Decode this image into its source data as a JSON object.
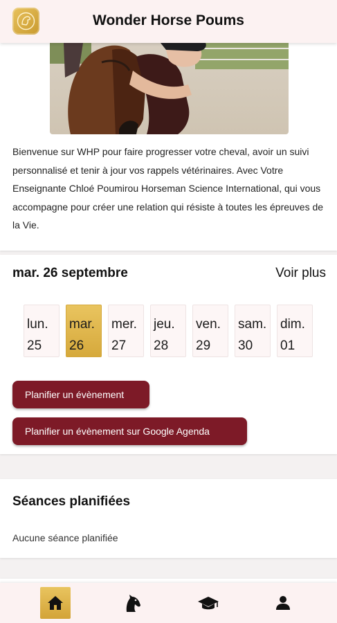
{
  "app": {
    "title": "Wonder Horse Poums"
  },
  "intro": {
    "text": "Bienvenue sur WHP pour faire progresser votre cheval, avoir un suivi personnalisé et tenir à jour vos rappels vétérinaires. Avec Votre Enseignante Chloé Poumirou Horseman Science International, qui vous accompagne pour créer une relation qui résiste à toutes les épreuves de la Vie."
  },
  "calendar": {
    "current_date": "mar. 26 septembre",
    "see_more": "Voir plus",
    "days": [
      {
        "name": "lun.",
        "num": "25",
        "selected": false
      },
      {
        "name": "mar.",
        "num": "26",
        "selected": true
      },
      {
        "name": "mer.",
        "num": "27",
        "selected": false
      },
      {
        "name": "jeu.",
        "num": "28",
        "selected": false
      },
      {
        "name": "ven.",
        "num": "29",
        "selected": false
      },
      {
        "name": "sam.",
        "num": "30",
        "selected": false
      },
      {
        "name": "dim.",
        "num": "01",
        "selected": false
      }
    ],
    "plan_event": "Planifier un évènement",
    "plan_google": "Planifier un évènement sur Google Agenda"
  },
  "sessions": {
    "title": "Séances planifiées",
    "empty": "Aucune séance planifiée"
  },
  "nav": {
    "items": [
      {
        "icon": "home-icon",
        "active": true
      },
      {
        "icon": "horse-head-icon",
        "active": false
      },
      {
        "icon": "graduation-cap-icon",
        "active": false
      },
      {
        "icon": "person-icon",
        "active": false
      }
    ]
  },
  "colors": {
    "accent_gold": "#e0b64d",
    "button_bg": "#7d1a27",
    "header_bg": "#fcf2f2"
  }
}
